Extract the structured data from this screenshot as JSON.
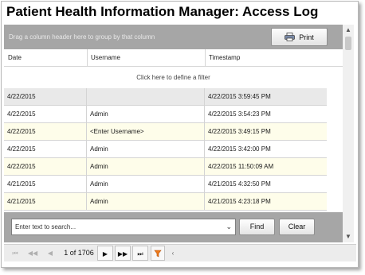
{
  "window": {
    "title": "Patient Health Information Manager:  Access Log"
  },
  "grid": {
    "group_hint": "Drag a column header here to group by that column",
    "print_label": "Print",
    "columns": [
      "Date",
      "Username",
      "Timestamp"
    ],
    "filter_hint": "Click here to define a filter",
    "rows": [
      {
        "date": "4/22/2015",
        "username": "",
        "timestamp": "4/22/2015 3:59:45 PM"
      },
      {
        "date": "4/22/2015",
        "username": "Admin",
        "timestamp": "4/22/2015 3:54:23 PM"
      },
      {
        "date": "4/22/2015",
        "username": "<Enter Username>",
        "timestamp": "4/22/2015 3:49:15 PM"
      },
      {
        "date": "4/22/2015",
        "username": "Admin",
        "timestamp": "4/22/2015 3:42:00 PM"
      },
      {
        "date": "4/22/2015",
        "username": "Admin",
        "timestamp": "4/22/2015 11:50:09 AM"
      },
      {
        "date": "4/21/2015",
        "username": "Admin",
        "timestamp": "4/21/2015 4:32:50 PM"
      },
      {
        "date": "4/21/2015",
        "username": "Admin",
        "timestamp": "4/21/2015 4:23:18 PM"
      }
    ]
  },
  "search": {
    "placeholder": "Enter text to search...",
    "find_label": "Find",
    "clear_label": "Clear"
  },
  "navigator": {
    "page_indicator": "1 of 1706"
  },
  "colors": {
    "panel_gray": "#a6a6a6",
    "row_alt": "#fefdea",
    "row_selected": "#e9e9e9",
    "filter_icon": "#f07a1a"
  },
  "icons": {
    "print": "printer-icon",
    "dropdown": "chevron-down-icon",
    "filter": "funnel-icon"
  }
}
